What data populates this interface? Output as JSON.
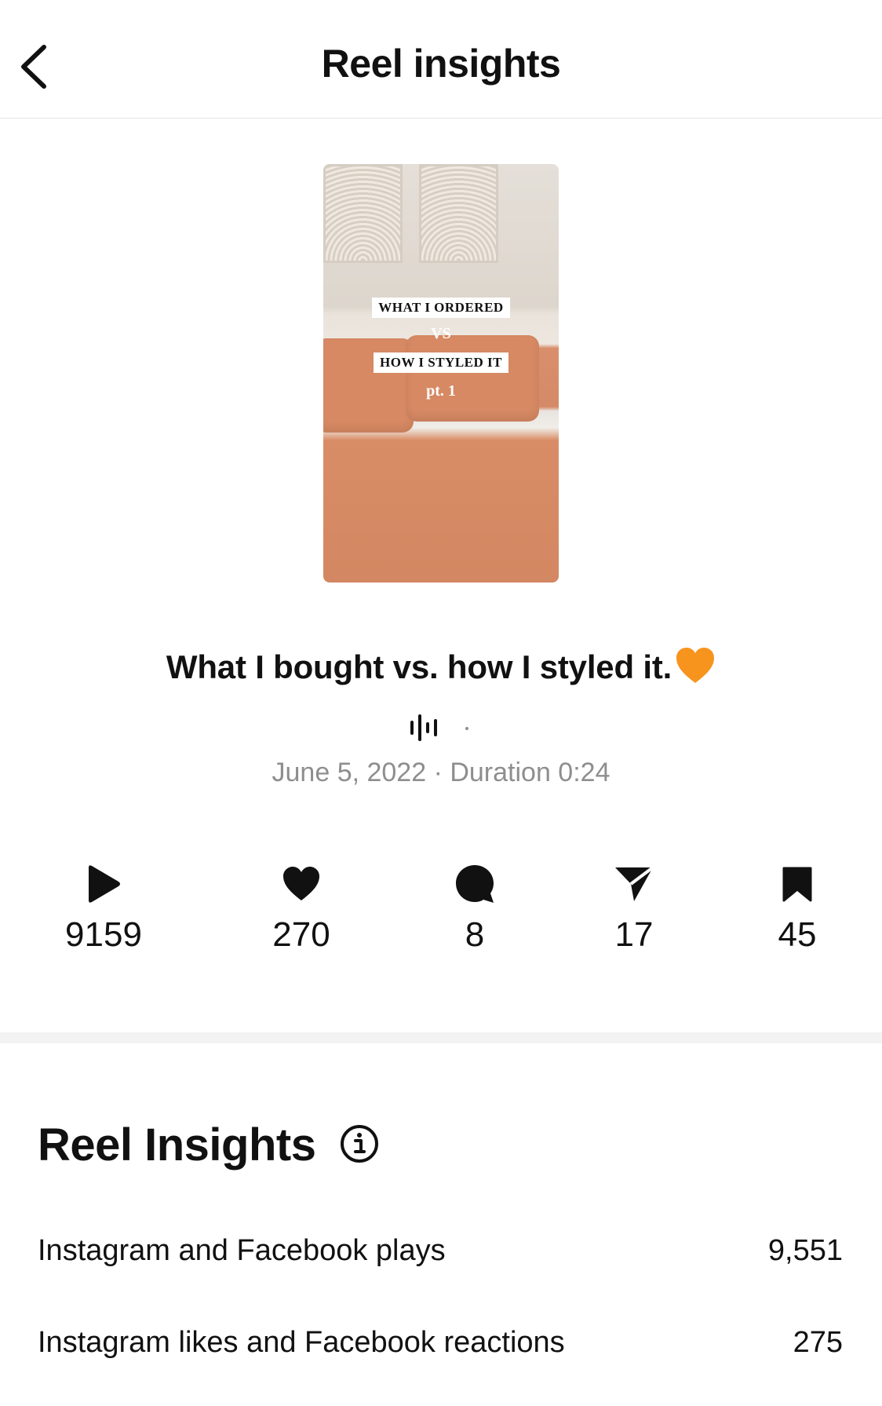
{
  "header": {
    "title": "Reel insights"
  },
  "reel": {
    "thumbnail_text": {
      "line1": "WHAT I ORDERED",
      "line2": "VS",
      "line3": "HOW I STYLED IT",
      "line4": "pt. 1"
    },
    "caption": "What I bought vs. how I styled it.",
    "caption_emoji": "orange-heart",
    "meta": "June 5, 2022 · Duration 0:24"
  },
  "stats": [
    {
      "icon": "play-icon",
      "value": "9159"
    },
    {
      "icon": "heart-icon",
      "value": "270"
    },
    {
      "icon": "comment-icon",
      "value": "8"
    },
    {
      "icon": "share-icon",
      "value": "17"
    },
    {
      "icon": "bookmark-icon",
      "value": "45"
    }
  ],
  "insights": {
    "title": "Reel Insights",
    "rows": [
      {
        "label": "Instagram and Facebook plays",
        "value": "9,551"
      },
      {
        "label": "Instagram likes and Facebook reactions",
        "value": "275"
      }
    ]
  },
  "colors": {
    "meta_gray": "#8e8e8e",
    "emoji_orange": "#f7941d",
    "divider": "#f3f3f3"
  }
}
